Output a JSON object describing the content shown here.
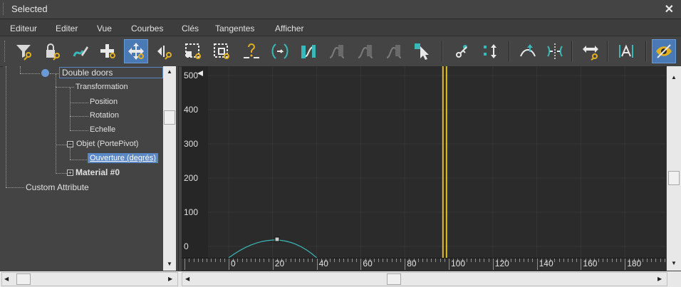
{
  "window": {
    "title": "Selected",
    "close_label": "✕"
  },
  "menu": [
    "Editeur",
    "Editer",
    "Vue",
    "Courbes",
    "Clés",
    "Tangentes",
    "Afficher"
  ],
  "toolbar": {
    "icons": [
      "filter-icon",
      "lock-key-icon",
      "draw-curve-icon",
      "add-key-icon",
      "move-keys-icon",
      "slide-keys-icon",
      "scale-keys-icon",
      "scale-values-icon",
      "snap-frames-icon",
      "parameter-curve-out-icon",
      "ease-curve-icon",
      "curve-wave-icon",
      "curve-wave-2-icon",
      "curve-wave-3-icon",
      "select-cursor-icon",
      "key-tangents-icon",
      "show-keys-icon",
      "tangent-up-icon",
      "flip-tangent-icon",
      "time-range-icon",
      "lock-tangent-icon",
      "view-icon"
    ]
  },
  "tree": {
    "root": "Double doors",
    "transformation": "Transformation",
    "position": "Position",
    "rotation": "Rotation",
    "echelle": "Echelle",
    "objet": "Objet (PortePivot)",
    "ouverture": "Ouverture (degrés)",
    "material": "Material #0",
    "custom": "Custom Attribute"
  },
  "graph": {
    "y_labels": [
      "500",
      "400",
      "300",
      "200",
      "100",
      "0"
    ],
    "x_labels": [
      "0",
      "20",
      "40",
      "60",
      "80",
      "100",
      "120",
      "140",
      "160",
      "180"
    ],
    "time_marker_frame": 98,
    "key_frame": 22,
    "curve_color": "#3ab8b8",
    "marker_color": "#e0c030"
  }
}
